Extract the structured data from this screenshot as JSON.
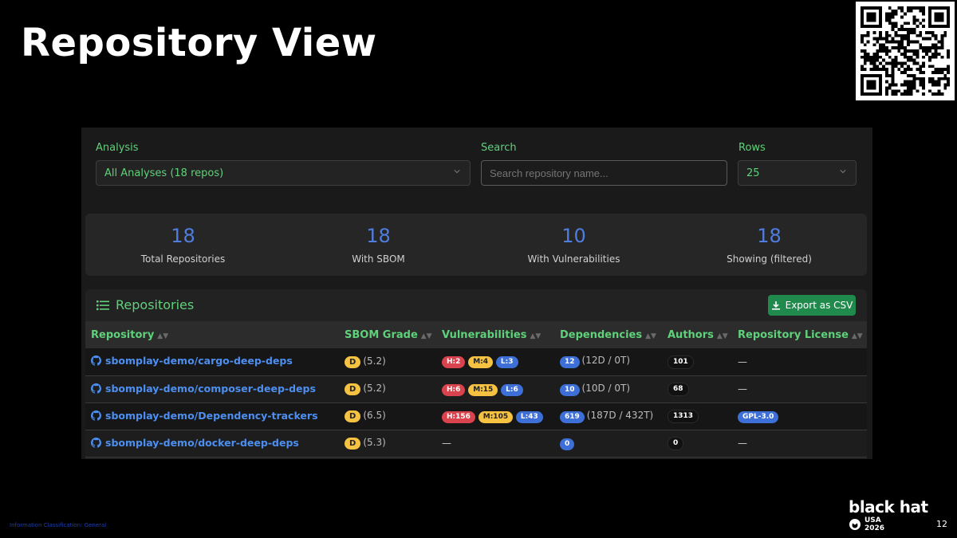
{
  "slide": {
    "title": "Repository View",
    "classification": "Information Classification: General",
    "logo_main": "black hat",
    "logo_sub_1": "USA",
    "logo_sub_2": "2026",
    "page_number": "12"
  },
  "filters": {
    "analysis_label": "Analysis",
    "analysis_value": "All Analyses (18 repos)",
    "search_label": "Search",
    "search_placeholder": "Search repository name...",
    "rows_label": "Rows",
    "rows_value": "25"
  },
  "stats": [
    {
      "value": "18",
      "label": "Total Repositories"
    },
    {
      "value": "18",
      "label": "With SBOM"
    },
    {
      "value": "10",
      "label": "With Vulnerabilities"
    },
    {
      "value": "18",
      "label": "Showing (filtered)"
    }
  ],
  "repositories": {
    "title": "Repositories",
    "export_label": "Export as CSV",
    "columns": [
      "Repository",
      "SBOM Grade",
      "Vulnerabilities",
      "Dependencies",
      "Authors",
      "Repository License"
    ],
    "rows": [
      {
        "name": "sbomplay-demo/cargo-deep-deps",
        "grade": "D",
        "score": "(5.2)",
        "high": "H:2",
        "medium": "M:4",
        "low": "L:3",
        "vuln_none": "",
        "deps": "12",
        "deps_detail": "(12D / 0T)",
        "authors": "101",
        "license": "",
        "license_none": "—"
      },
      {
        "name": "sbomplay-demo/composer-deep-deps",
        "grade": "D",
        "score": "(5.2)",
        "high": "H:6",
        "medium": "M:15",
        "low": "L:6",
        "vuln_none": "",
        "deps": "10",
        "deps_detail": "(10D / 0T)",
        "authors": "68",
        "license": "",
        "license_none": "—"
      },
      {
        "name": "sbomplay-demo/Dependency-trackers",
        "grade": "D",
        "score": "(6.5)",
        "high": "H:156",
        "medium": "M:105",
        "low": "L:43",
        "vuln_none": "",
        "deps": "619",
        "deps_detail": "(187D / 432T)",
        "authors": "1313",
        "license": "GPL-3.0",
        "license_none": ""
      },
      {
        "name": "sbomplay-demo/docker-deep-deps",
        "grade": "D",
        "score": "(5.3)",
        "high": "",
        "medium": "",
        "low": "",
        "vuln_none": "—",
        "deps": "0",
        "deps_detail": "",
        "authors": "0",
        "license": "",
        "license_none": "—"
      }
    ]
  },
  "icons": {
    "chevron": "chevron-down-icon",
    "list": "list-icon",
    "download": "download-icon",
    "github": "github-icon",
    "sort": "sort-icon",
    "qr": "qr-code-icon",
    "globe": "globe-icon"
  },
  "colors": {
    "accent_green": "#5fd17a",
    "stat_blue": "#4f7de0",
    "link_blue": "#4d8ff0",
    "high": "#d9434e",
    "medium": "#f5c242",
    "low": "#3d6fd6",
    "export_button": "#1f8a4c"
  }
}
